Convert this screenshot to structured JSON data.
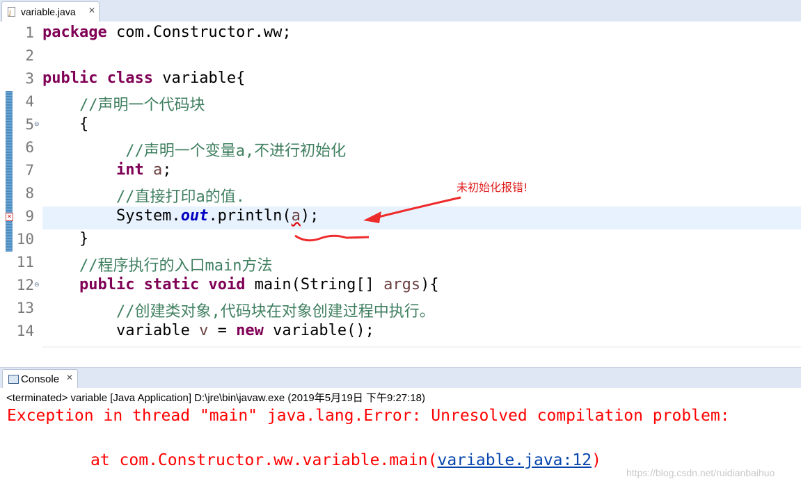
{
  "editor_tab": {
    "title": "variable.java",
    "close_icon": "close-icon"
  },
  "code_lines": [
    {
      "num": "1"
    },
    {
      "num": "2"
    },
    {
      "num": "3"
    },
    {
      "num": "4"
    },
    {
      "num": "5"
    },
    {
      "num": "6"
    },
    {
      "num": "7"
    },
    {
      "num": "8"
    },
    {
      "num": "9"
    },
    {
      "num": "10"
    },
    {
      "num": "11"
    },
    {
      "num": "12"
    },
    {
      "num": "13"
    },
    {
      "num": "14"
    }
  ],
  "code_text": {
    "l1_kw": "package",
    "l1_rest": " com.Constructor.ww;",
    "l3_kw1": "public",
    "l3_kw2": "class",
    "l3_rest": " variable{",
    "l4_cm": "    //声明一个代码块",
    "l5": "    {",
    "l6_cm": "         //声明一个变量a,不进行初始化",
    "l7_indent": "        ",
    "l7_kw": "int",
    "l7_var": "a",
    "l7_end": ";",
    "l8_cm": "        //直接打印a的值.",
    "l9_pre": "        System.",
    "l9_field": "out",
    "l9_mid": ".println(",
    "l9_var": "a",
    "l9_end": ");",
    "l10": "    }",
    "l11_cm": "    //程序执行的入口main方法",
    "l12_indent": "    ",
    "l12_kw1": "public",
    "l12_kw2": "static",
    "l12_kw3": "void",
    "l12_mid": " main(String[] ",
    "l12_var": "args",
    "l12_end": "){",
    "l13_cm": "        //创建类对象,代码块在对象创建过程中执行。",
    "l14_pre": "        variable ",
    "l14_var": "v",
    "l14_mid": " = ",
    "l14_kw": "new",
    "l14_end": " variable();"
  },
  "annotation": {
    "text": "未初始化报错!",
    "color": "#e02020"
  },
  "console_tab": {
    "title": "Console",
    "icon": "console-icon",
    "close_icon": "close-icon"
  },
  "console": {
    "status": "<terminated> variable [Java Application] D:\\jre\\bin\\javaw.exe (2019年5月19日 下午9:27:18)",
    "error_line1": "Exception in thread \"main\" java.lang.Error: Unresolved compilation problem:",
    "error_line2_prefix": "at com.Constructor.ww.variable.main(",
    "error_link": "variable.java:12",
    "error_line2_suffix": ")"
  },
  "watermark": "https://blog.csdn.net/ruidianbaihuo",
  "colors": {
    "keyword": "#7f0055",
    "comment": "#3f7f5f",
    "error": "#ff0000",
    "current_line": "#e8f2fe"
  }
}
